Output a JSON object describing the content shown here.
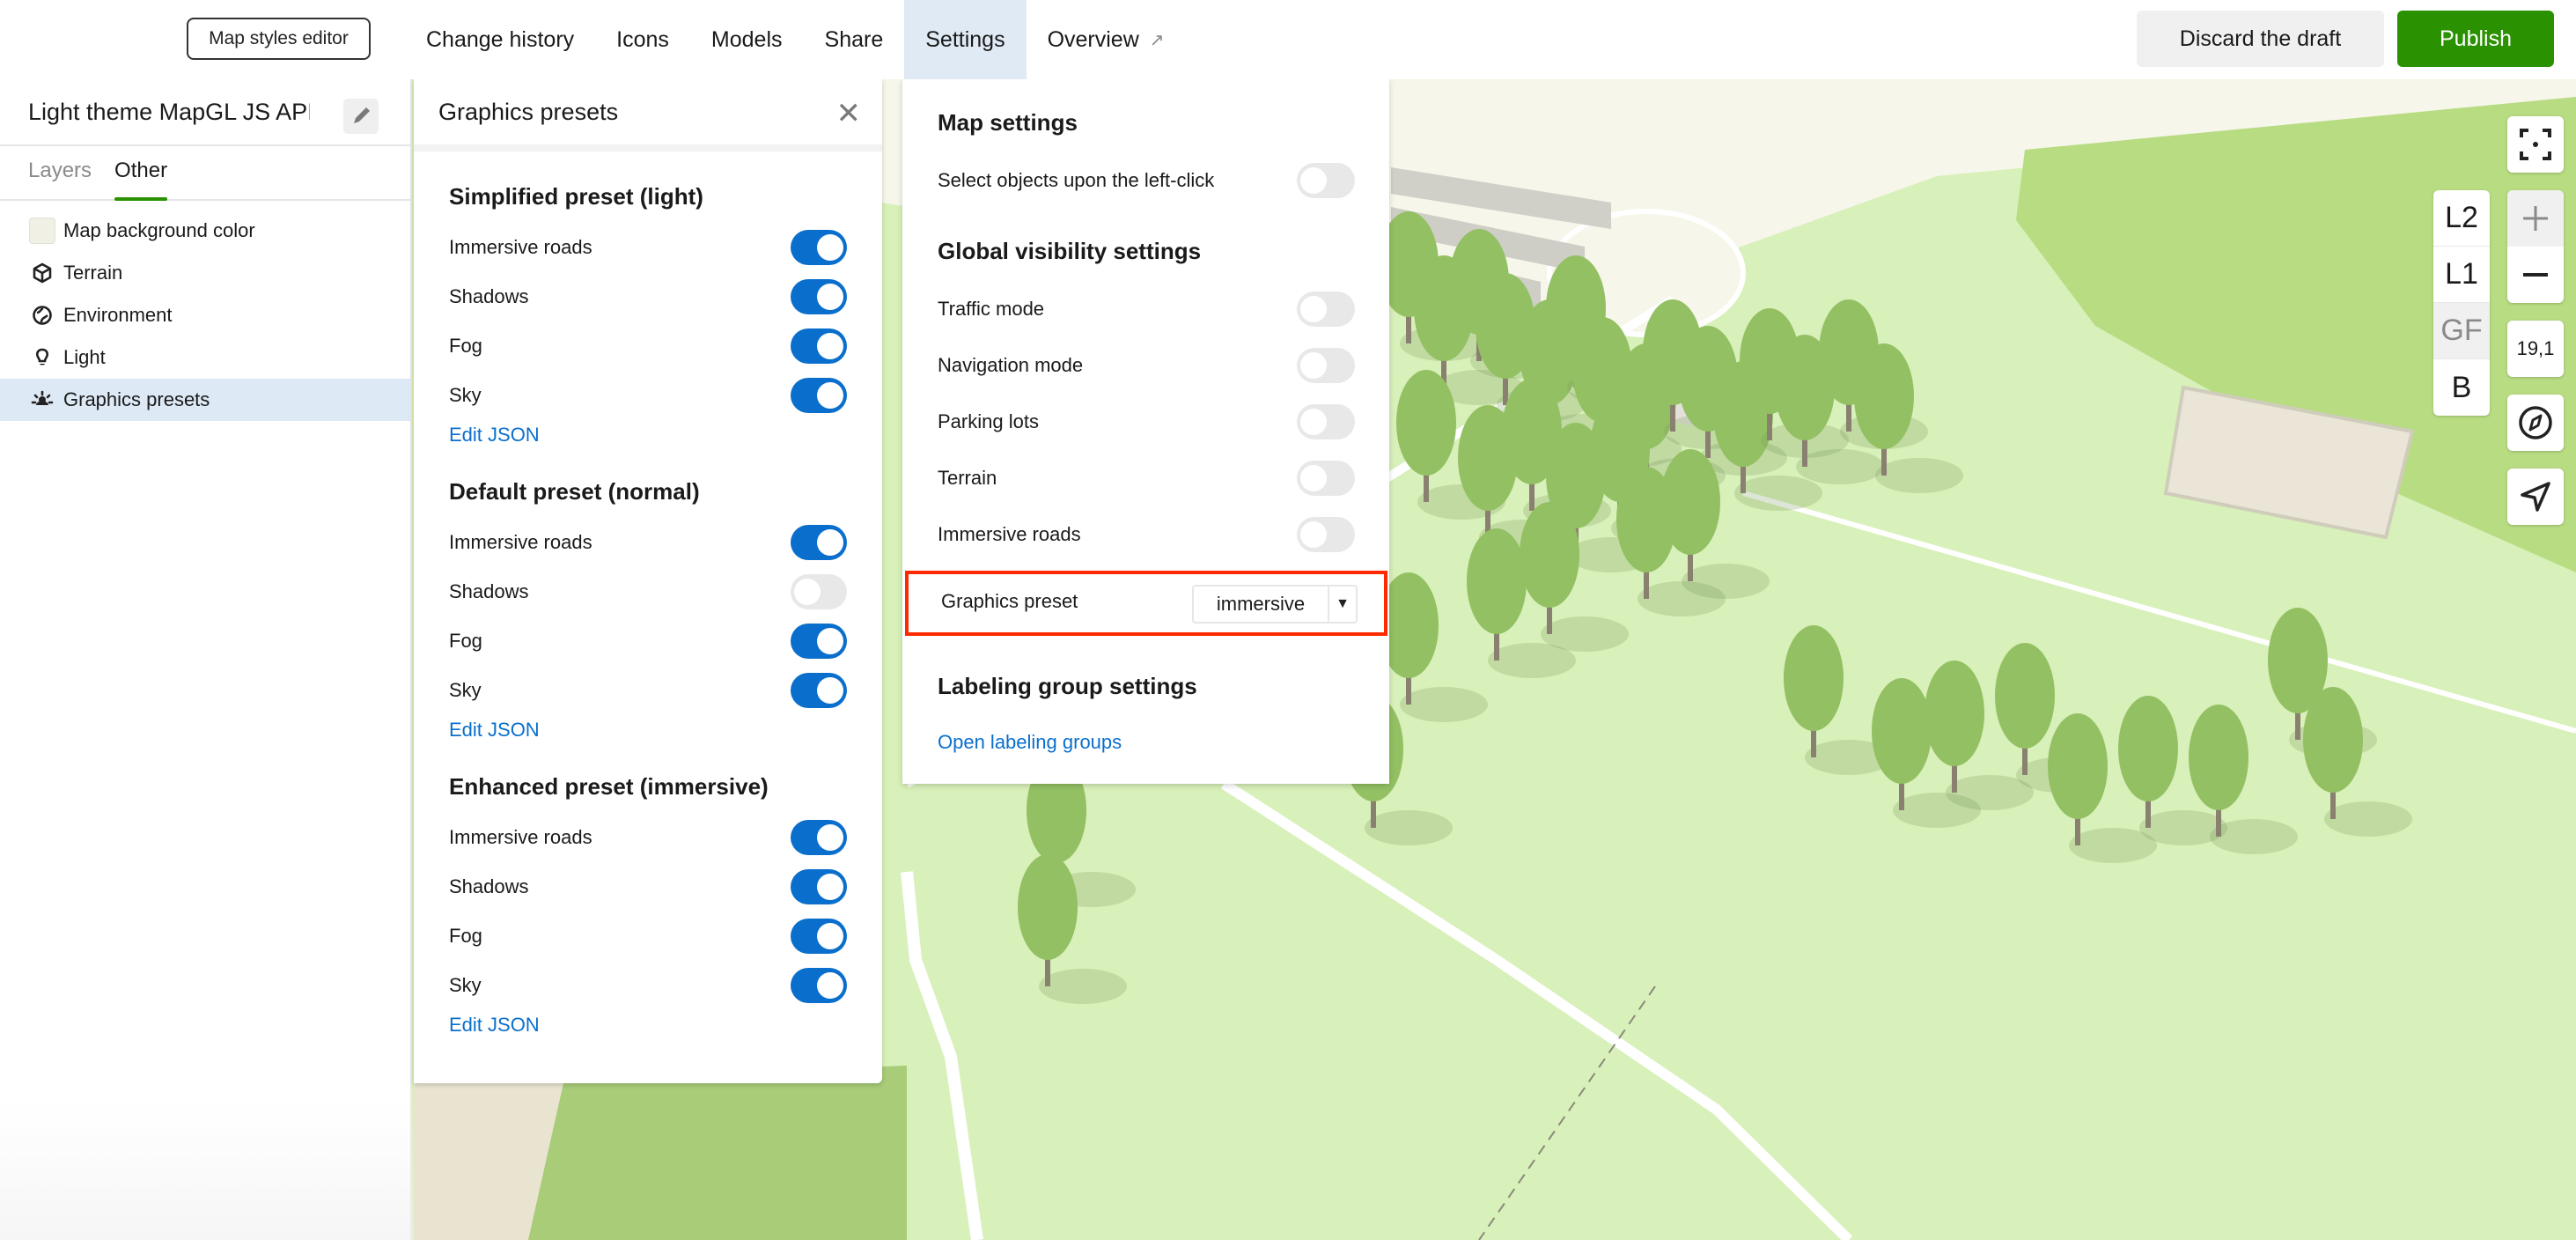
{
  "topbar": {
    "editor_button": "Map styles editor",
    "nav": [
      {
        "label": "Change history",
        "active": false
      },
      {
        "label": "Icons",
        "active": false
      },
      {
        "label": "Models",
        "active": false
      },
      {
        "label": "Share",
        "active": false
      },
      {
        "label": "Settings",
        "active": true
      },
      {
        "label": "Overview",
        "active": false,
        "external": true
      }
    ],
    "external_icon": "arrow-up-right-icon",
    "discard_label": "Discard the draft",
    "publish_label": "Publish",
    "publish_color": "#2a9200"
  },
  "sidebar": {
    "style_name": "Light theme MapGL JS API",
    "edit_icon": "pencil-icon",
    "tabs": [
      {
        "label": "Layers",
        "active": false
      },
      {
        "label": "Other",
        "active": true
      }
    ],
    "items": [
      {
        "label": "Map background color",
        "icon": "color-swatch",
        "active": false
      },
      {
        "label": "Terrain",
        "icon": "cube-icon",
        "active": false
      },
      {
        "label": "Environment",
        "icon": "globe-icon",
        "active": false
      },
      {
        "label": "Light",
        "icon": "lightbulb-icon",
        "active": false
      },
      {
        "label": "Graphics presets",
        "icon": "sun-gear-icon",
        "active": true
      }
    ]
  },
  "graphics_presets_panel": {
    "title": "Graphics presets",
    "close_icon": "close-icon",
    "presets": [
      {
        "title": "Simplified preset (light)",
        "options": [
          {
            "label": "Immersive roads",
            "enabled": true
          },
          {
            "label": "Shadows",
            "enabled": true
          },
          {
            "label": "Fog",
            "enabled": true
          },
          {
            "label": "Sky",
            "enabled": true
          }
        ],
        "link": "Edit JSON"
      },
      {
        "title": "Default preset (normal)",
        "options": [
          {
            "label": "Immersive roads",
            "enabled": true
          },
          {
            "label": "Shadows",
            "enabled": false
          },
          {
            "label": "Fog",
            "enabled": true
          },
          {
            "label": "Sky",
            "enabled": true
          }
        ],
        "link": "Edit JSON"
      },
      {
        "title": "Enhanced preset (immersive)",
        "options": [
          {
            "label": "Immersive roads",
            "enabled": true
          },
          {
            "label": "Shadows",
            "enabled": true
          },
          {
            "label": "Fog",
            "enabled": true
          },
          {
            "label": "Sky",
            "enabled": true
          }
        ],
        "link": "Edit JSON"
      }
    ]
  },
  "settings_panel": {
    "map_settings_title": "Map settings",
    "map_settings": [
      {
        "label": "Select objects upon the left-click",
        "enabled": false
      }
    ],
    "visibility_title": "Global visibility settings",
    "visibility": [
      {
        "label": "Traffic mode",
        "enabled": false
      },
      {
        "label": "Navigation mode",
        "enabled": false
      },
      {
        "label": "Parking lots",
        "enabled": false
      },
      {
        "label": "Terrain",
        "enabled": false
      },
      {
        "label": "Immersive roads",
        "enabled": false
      }
    ],
    "graphics_preset_label": "Graphics preset",
    "graphics_preset_value": "immersive",
    "labeling_title": "Labeling group settings",
    "labeling_link": "Open labeling groups",
    "highlight_color": "#ff2a00"
  },
  "map_controls": {
    "fullscreen_icon": "fullscreen-icon",
    "floors": [
      {
        "label": "L2",
        "active": false
      },
      {
        "label": "L1",
        "active": false
      },
      {
        "label": "GF",
        "active": true
      },
      {
        "label": "B",
        "active": false
      }
    ],
    "zoom_in_icon": "plus-icon",
    "zoom_out_icon": "minus-icon",
    "zoom_level": "19,1",
    "compass_icon": "compass-icon",
    "geolocate_icon": "navigation-arrow-icon"
  },
  "colors": {
    "accent_blue": "#0a6fcc",
    "toggle_off": "#e8e8e8",
    "active_nav_bg": "#e0eaf4",
    "map_grass": "#d6efb6",
    "map_park": "#b6da80"
  }
}
